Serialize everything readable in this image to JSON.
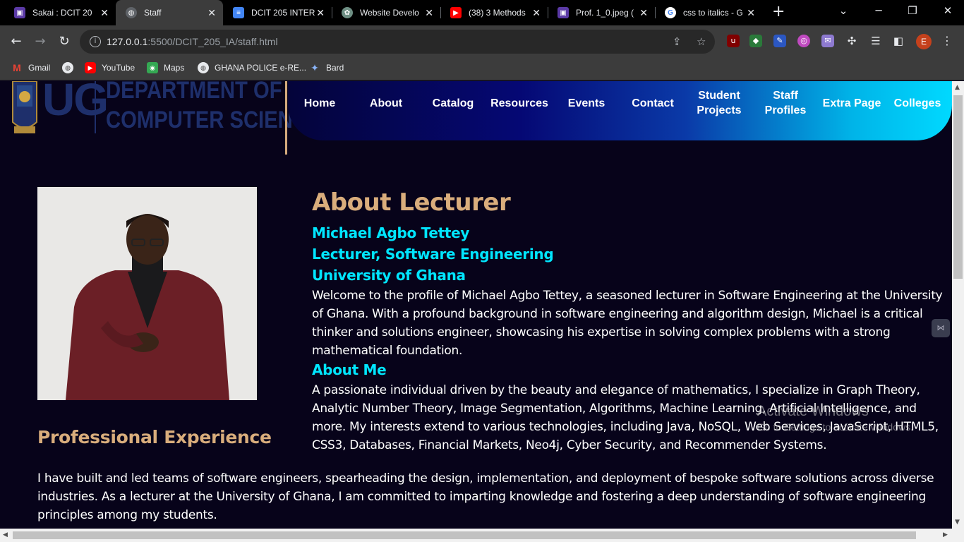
{
  "browser": {
    "tabs": [
      {
        "title": "Sakai : DCIT 20",
        "icon": "sakai-icon",
        "color": "#5b3aa6"
      },
      {
        "title": "Staff",
        "icon": "globe-icon",
        "color": "#5f6368",
        "active": true
      },
      {
        "title": "DCIT 205 INTER",
        "icon": "docs-icon",
        "color": "#4285f4"
      },
      {
        "title": "Website Develo",
        "icon": "chatgpt-icon",
        "color": "#6e8f84"
      },
      {
        "title": "(38) 3 Methods",
        "icon": "youtube-icon",
        "color": "#ff0000"
      },
      {
        "title": "Prof. 1_0.jpeg (",
        "icon": "sakai-icon",
        "color": "#5b3aa6"
      },
      {
        "title": "css to italics - G",
        "icon": "google-icon",
        "color": "#4285f4"
      }
    ],
    "url_host": "127.0.0.1",
    "url_path": ":5500/DCIT_205_IA/staff.html",
    "profile_initial": "E",
    "bookmarks": [
      {
        "label": "Gmail",
        "icon": "gmail-icon"
      },
      {
        "label": "",
        "icon": "globe-icon"
      },
      {
        "label": "YouTube",
        "icon": "youtube-icon"
      },
      {
        "label": "Maps",
        "icon": "maps-icon"
      },
      {
        "label": "GHANA POLICE e-RE...",
        "icon": "globe-icon"
      },
      {
        "label": "Bard",
        "icon": "bard-icon"
      }
    ]
  },
  "site": {
    "logo_letters": "UG",
    "logo_line1": "DEPARTMENT OF",
    "logo_line2": "COMPUTER SCIENCE",
    "nav": [
      {
        "label": "Home"
      },
      {
        "label": "About"
      },
      {
        "label": "Catalog"
      },
      {
        "label": "Resources"
      },
      {
        "label": "Events"
      },
      {
        "label": "Contact"
      },
      {
        "label": "Student Projects"
      },
      {
        "label": "Staff Profiles"
      },
      {
        "label": "Extra Page"
      },
      {
        "label": "Colleges"
      }
    ]
  },
  "profile": {
    "section_title": "About Lecturer",
    "name": "Michael Agbo Tettey",
    "position": "Lecturer, Software Engineering",
    "institution": "University of Ghana",
    "intro": "Welcome to the profile of Michael Agbo Tettey, a seasoned lecturer in Software Engineering at the University of Ghana. With a profound background in software engineering and algorithm design, Michael is a critical thinker and solutions engineer, showcasing his expertise in solving complex problems with a strong mathematical foundation.",
    "about_me_title": "About Me",
    "about_me": "A passionate individual driven by the beauty and elegance of mathematics, I specialize in Graph Theory, Analytic Number Theory, Image Segmentation, Algorithms, Machine Learning, Artificial Intelligence, and more. My interests extend to various technologies, including Java, NoSQL, Web Services, JavaScript, HTML5, CSS3, Databases, Financial Markets, Neo4j, Cyber Security, and Recommender Systems.",
    "experience_title": "Professional Experience",
    "experience": "I have built and led teams of software engineers, spearheading the design, implementation, and deployment of bespoke software solutions across diverse industries. As a lecturer at the University of Ghana, I am committed to imparting knowledge and fostering a deep understanding of software engineering principles among my students."
  },
  "overlay": {
    "activate_line1": "Activate Windows",
    "activate_line2": "Go to Settings to activate Windows."
  }
}
